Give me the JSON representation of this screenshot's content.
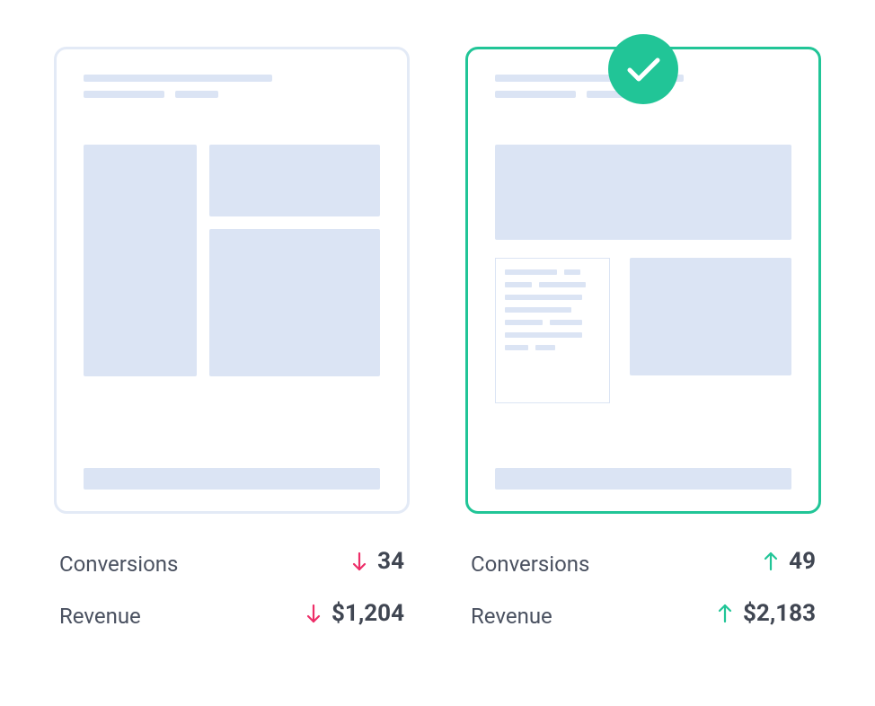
{
  "colors": {
    "accent_green": "#21c597",
    "accent_red": "#ed2e68",
    "placeholder": "#dbe4f4"
  },
  "variant_a": {
    "selected": false,
    "metrics": {
      "conversions_label": "Conversions",
      "conversions_value": "34",
      "conversions_direction": "down",
      "revenue_label": "Revenue",
      "revenue_value": "$1,204",
      "revenue_direction": "down"
    }
  },
  "variant_b": {
    "selected": true,
    "metrics": {
      "conversions_label": "Conversions",
      "conversions_value": "49",
      "conversions_direction": "up",
      "revenue_label": "Revenue",
      "revenue_value": "$2,183",
      "revenue_direction": "up"
    }
  }
}
